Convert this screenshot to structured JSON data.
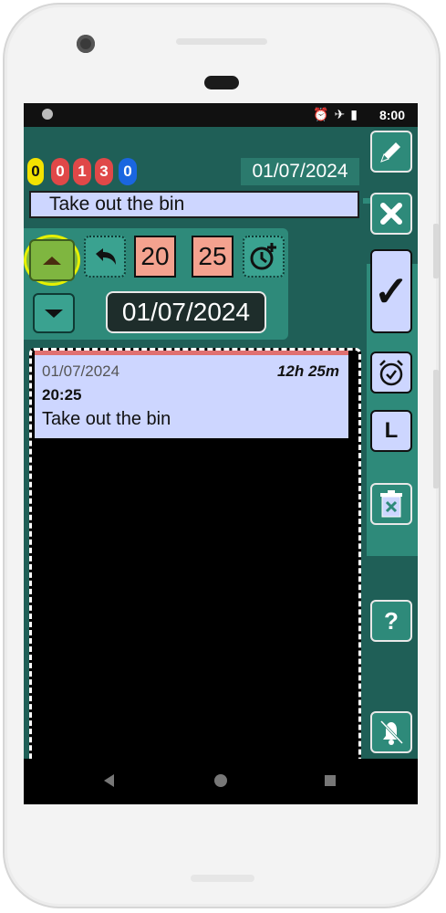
{
  "status_bar": {
    "time": "8:00",
    "icons": [
      "alarm-icon",
      "airplane-icon",
      "battery-icon"
    ]
  },
  "counters": [
    {
      "value": "0",
      "color": "#f3e200",
      "text_color": "#111111"
    },
    {
      "value": "0",
      "color": "#e04848",
      "text_color": "#ffffff"
    },
    {
      "value": "1",
      "color": "#e04848",
      "text_color": "#ffffff"
    },
    {
      "value": "3",
      "color": "#e04848",
      "text_color": "#ffffff"
    },
    {
      "value": "0",
      "color": "#1a66e0",
      "text_color": "#ffffff"
    }
  ],
  "header": {
    "date": "01/07/2024"
  },
  "title_input": {
    "value": "Take out the bin"
  },
  "time_editor": {
    "hours": "20",
    "separator": ":",
    "minutes": "25"
  },
  "date_editor": {
    "date": "01/07/2024"
  },
  "reminders": [
    {
      "date": "01/07/2024",
      "remaining": "12h 25m",
      "time": "20:25",
      "title": "Take out the bin"
    }
  ],
  "right_toolbar": {
    "confirm": "✓",
    "list": "L",
    "help": "?"
  },
  "colors": {
    "accent": "#2e8a7a",
    "background": "#1f5f57",
    "field": "#cdd6ff",
    "time_box": "#f4a28f",
    "highlight_ring": "#e6f000"
  }
}
